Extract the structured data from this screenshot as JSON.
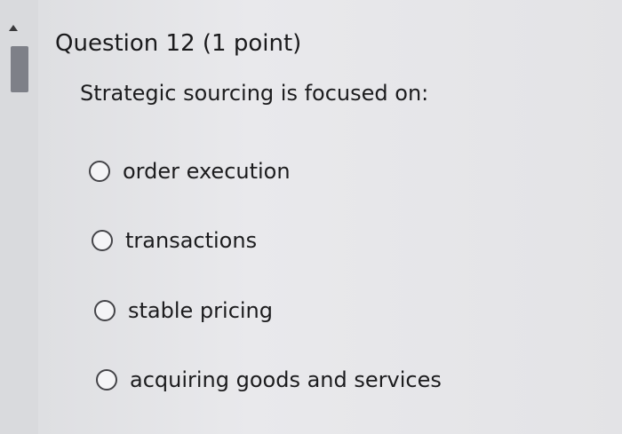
{
  "question": {
    "title": "Question 12 (1 point)",
    "text": "Strategic sourcing is focused on:"
  },
  "options": [
    {
      "label": "order execution",
      "selected": false
    },
    {
      "label": "transactions",
      "selected": false
    },
    {
      "label": "stable pricing",
      "selected": false
    },
    {
      "label": "acquiring goods and services",
      "selected": false
    }
  ],
  "icons": {
    "scroll_up": "scroll-up-arrow-icon",
    "radio": "radio-button-icon"
  }
}
